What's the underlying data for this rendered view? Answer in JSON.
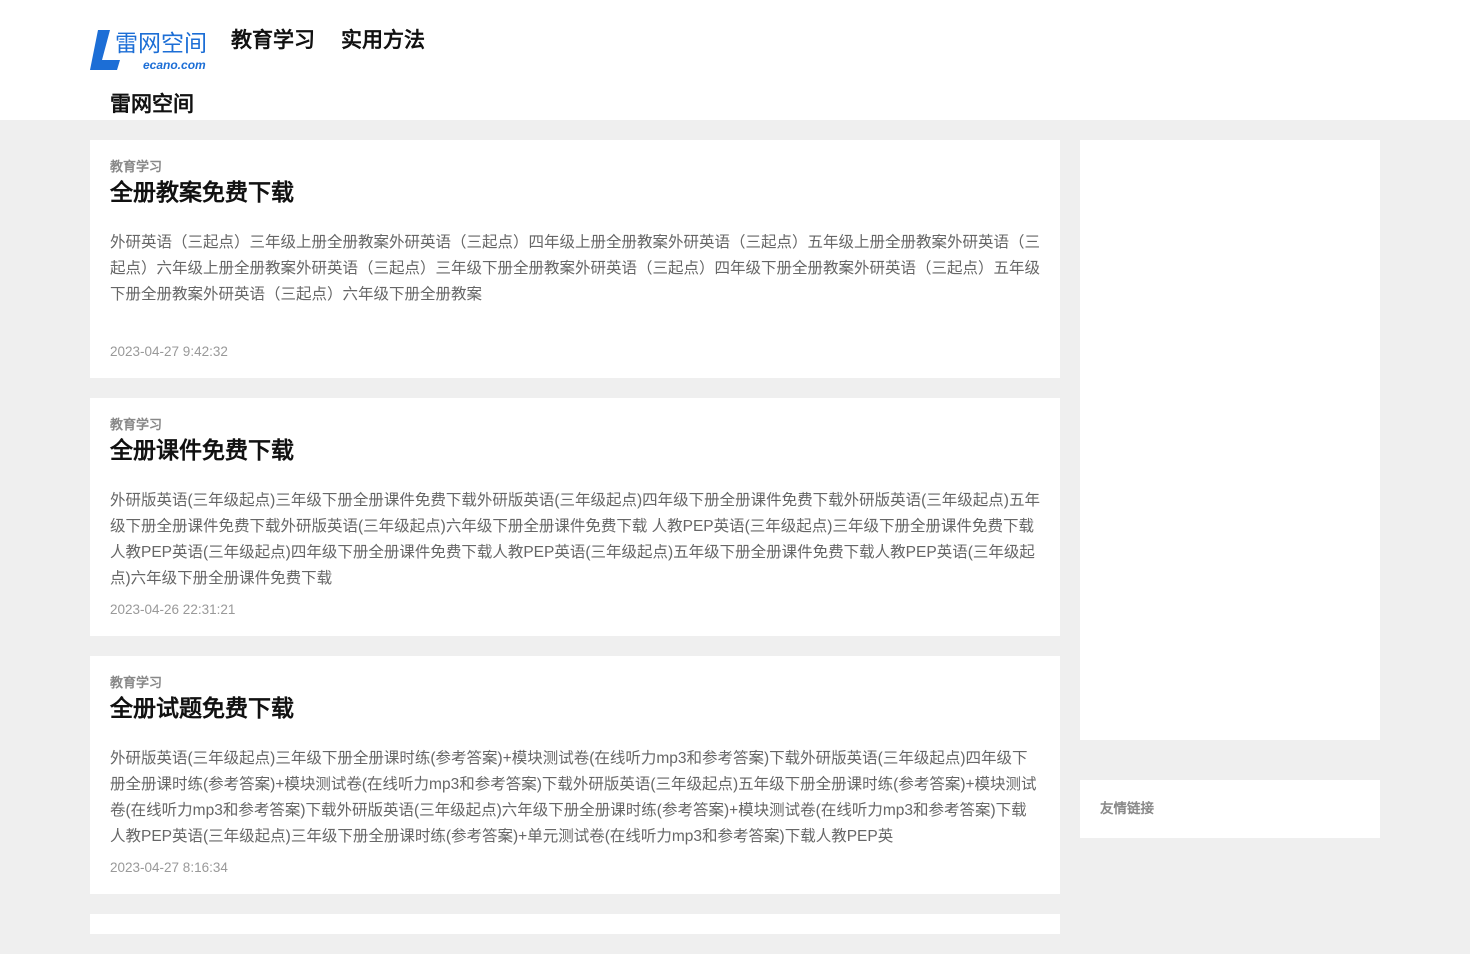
{
  "header": {
    "logo": {
      "cn": "雷网空间",
      "en": "ecano.com",
      "brand_color": "#1c6ed6"
    },
    "nav": [
      "教育学习",
      "实用方法"
    ],
    "site_name": "雷网空间"
  },
  "posts": [
    {
      "category": "教育学习",
      "title": "全册教案免费下载",
      "excerpt": "外研英语（三起点）三年级上册全册教案外研英语（三起点）四年级上册全册教案外研英语（三起点）五年级上册全册教案外研英语（三起点）六年级上册全册教案外研英语（三起点）三年级下册全册教案外研英语（三起点）四年级下册全册教案外研英语（三起点）五年级下册全册教案外研英语（三起点）六年级下册全册教案",
      "date": "2023-04-27 9:42:32"
    },
    {
      "category": "教育学习",
      "title": "全册课件免费下载",
      "excerpt": "外研版英语(三年级起点)三年级下册全册课件免费下载外研版英语(三年级起点)四年级下册全册课件免费下载外研版英语(三年级起点)五年级下册全册课件免费下载外研版英语(三年级起点)六年级下册全册课件免费下载 人教PEP英语(三年级起点)三年级下册全册课件免费下载人教PEP英语(三年级起点)四年级下册全册课件免费下载人教PEP英语(三年级起点)五年级下册全册课件免费下载人教PEP英语(三年级起点)六年级下册全册课件免费下载",
      "date": "2023-04-26 22:31:21"
    },
    {
      "category": "教育学习",
      "title": "全册试题免费下载",
      "excerpt": "外研版英语(三年级起点)三年级下册全册课时练(参考答案)+模块测试卷(在线听力mp3和参考答案)下载外研版英语(三年级起点)四年级下册全册课时练(参考答案)+模块测试卷(在线听力mp3和参考答案)下载外研版英语(三年级起点)五年级下册全册课时练(参考答案)+模块测试卷(在线听力mp3和参考答案)下载外研版英语(三年级起点)六年级下册全册课时练(参考答案)+模块测试卷(在线听力mp3和参考答案)下载人教PEP英语(三年级起点)三年级下册全册课时练(参考答案)+单元测试卷(在线听力mp3和参考答案)下载人教PEP英",
      "date": "2023-04-27 8:16:34"
    }
  ],
  "sidebar": {
    "links_heading": "友情链接"
  }
}
